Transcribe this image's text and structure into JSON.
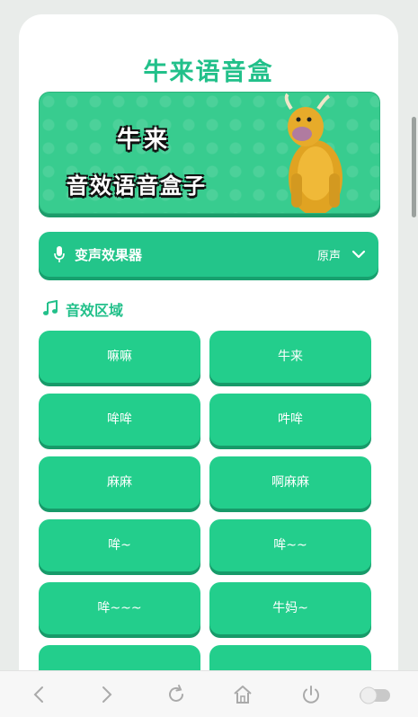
{
  "app": {
    "title": "牛来语音盒"
  },
  "banner": {
    "line1": "牛来",
    "line2": "音效语音盒子"
  },
  "voice_changer": {
    "label": "变声效果器",
    "value": "原声"
  },
  "section": {
    "title": "音效区域"
  },
  "sounds": [
    {
      "label": "嘛嘛"
    },
    {
      "label": "牛来"
    },
    {
      "label": "哞哞"
    },
    {
      "label": "吽哞"
    },
    {
      "label": "麻麻"
    },
    {
      "label": "啊麻麻"
    },
    {
      "label": "哞~"
    },
    {
      "label": "哞~~"
    },
    {
      "label": "哞~~~"
    },
    {
      "label": "牛妈~"
    },
    {
      "label": ""
    },
    {
      "label": ""
    }
  ],
  "colors": {
    "accent": "#22c08a",
    "button": "#23ce8c",
    "button_shadow": "#179a69"
  },
  "bottom_nav": {
    "icons": [
      "back-icon",
      "forward-icon",
      "refresh-icon",
      "home-icon",
      "power-icon",
      "toggle-icon"
    ]
  }
}
